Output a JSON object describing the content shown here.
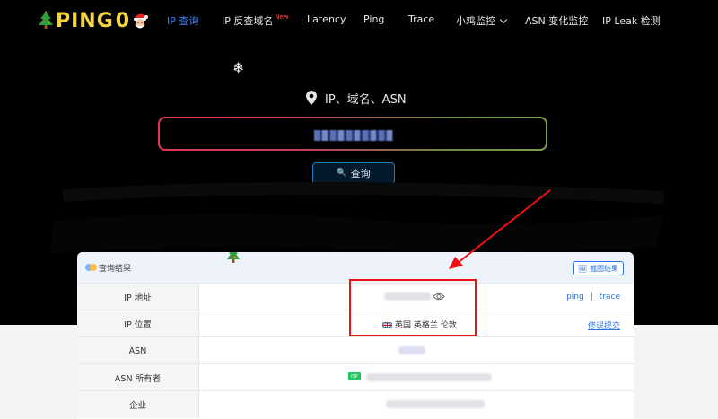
{
  "nav": {
    "logo_text": "PING",
    "logo_zero": "0",
    "items": [
      {
        "label": "IP 查询",
        "active": true
      },
      {
        "label": "IP 反查域名",
        "badge": "New"
      },
      {
        "label": "Latency"
      },
      {
        "label": "Ping"
      },
      {
        "label": "Trace"
      },
      {
        "label": "小鸡监控"
      },
      {
        "label": "ASN 变化监控"
      },
      {
        "label": "IP Leak 检测"
      }
    ]
  },
  "search": {
    "title": "IP、域名、ASN",
    "button_label": "查询"
  },
  "result": {
    "title": "查询结果",
    "screenshot_label": "截图结果",
    "rows": [
      {
        "label": "IP 地址",
        "link1": "ping",
        "link_sep": "|",
        "link2": "trace"
      },
      {
        "label": "IP 位置",
        "value": "英国 英格兰 伦敦",
        "action": "修误提交"
      },
      {
        "label": "ASN"
      },
      {
        "label": "ASN 所有者",
        "badge": "ISP"
      },
      {
        "label": "企业"
      }
    ]
  },
  "colors": {
    "accent": "#3b82f6",
    "logo_yellow": "#f5d442",
    "annotation_red": "#e11111",
    "isp_green": "#22c55e"
  }
}
